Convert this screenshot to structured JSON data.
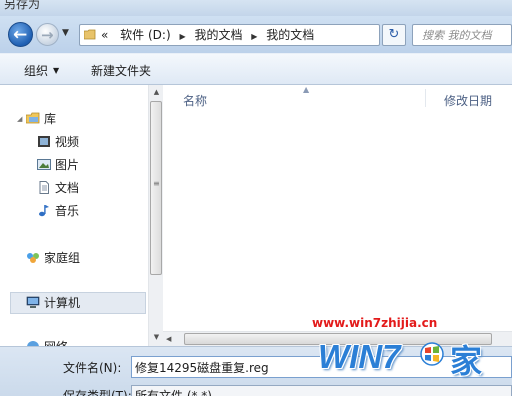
{
  "window": {
    "title": "另存为"
  },
  "address_bar": {
    "lead": "«",
    "crumbs": [
      "软件 (D:)",
      "我的文档",
      "我的文档"
    ],
    "search_placeholder": "搜索 我的文档"
  },
  "toolbar": {
    "organize_label": "组织",
    "new_folder_label": "新建文件夹"
  },
  "nav_pane": {
    "favorites_group_label": "库",
    "library_items": [
      "视频",
      "图片",
      "文档",
      "音乐"
    ],
    "homegroup_label": "家庭组",
    "computer_label": "计算机",
    "network_label": "网络"
  },
  "file_list": {
    "columns": [
      "名称",
      "修改日期"
    ]
  },
  "save_form": {
    "filename_label": "文件名(N):",
    "filename_value": "修复14295磁盘重复.reg",
    "filetype_label": "保存类型(T):",
    "filetype_value": "所有文件 (*.*)"
  },
  "watermark": {
    "url": "www.win7zhijia.cn",
    "logo_text": "WIN7",
    "logo_char": "家"
  },
  "colors": {
    "accent": "#2b7fd6",
    "watermark_red": "#e31b1b",
    "header_text": "#4d6185"
  }
}
